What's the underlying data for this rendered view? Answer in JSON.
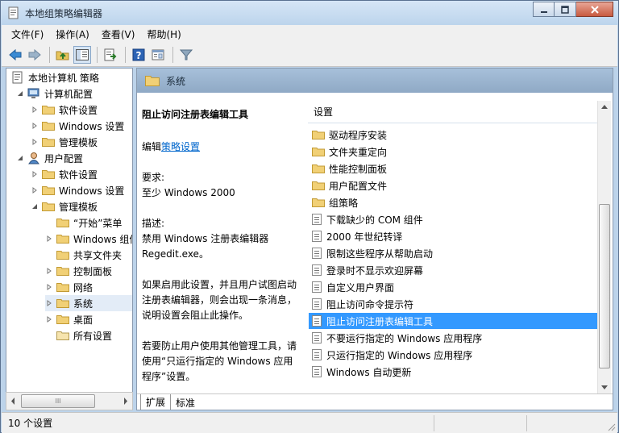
{
  "window": {
    "title": "本地组策略编辑器"
  },
  "menu": [
    "文件(F)",
    "操作(A)",
    "查看(V)",
    "帮助(H)"
  ],
  "tree": {
    "root": "本地计算机 策略",
    "computer": "计算机配置",
    "computer_children": [
      "软件设置",
      "Windows 设置",
      "管理模板"
    ],
    "user": "用户配置",
    "user_children": [
      "软件设置",
      "Windows 设置",
      "管理模板"
    ],
    "admin_children": [
      "“开始”菜单",
      "Windows 组件",
      "共享文件夹",
      "控制面板",
      "网络",
      "系统",
      "桌面",
      "所有设置"
    ],
    "hscroll_grip": "III"
  },
  "header": {
    "title": "系统"
  },
  "description": {
    "heading": "阻止访问注册表编辑工具",
    "edit_prefix": "编辑",
    "edit_link": "策略设置",
    "requirement_label": "要求:",
    "requirement": "至少 Windows 2000",
    "desc_label": "描述:",
    "desc_line1": "禁用 Windows 注册表编辑器",
    "desc_line2": "Regedit.exe。",
    "para1_l1": "如果启用此设置，并且用户试图启动",
    "para1_l2": "注册表编辑器，则会出现一条消息，",
    "para1_l3": "说明设置会阻止此操作。",
    "para2_l1": "若要防止用户使用其他管理工具，请",
    "para2_l2": "使用“只运行指定的 Windows 应用",
    "para2_l3": "程序”设置。"
  },
  "list": {
    "column": "设置",
    "folders": [
      "驱动程序安装",
      "文件夹重定向",
      "性能控制面板",
      "用户配置文件",
      "组策略"
    ],
    "policies": [
      "下载缺少的 COM 组件",
      "2000 年世纪转译",
      "限制这些程序从帮助启动",
      "登录时不显示欢迎屏幕",
      "自定义用户界面",
      "阻止访问命令提示符",
      "阻止访问注册表编辑工具",
      "不要运行指定的 Windows 应用程序",
      "只运行指定的 Windows 应用程序",
      "Windows 自动更新"
    ],
    "selected": "阻止访问注册表编辑工具"
  },
  "tabs": [
    "扩展",
    "标准"
  ],
  "status": {
    "text": "10 个设置"
  }
}
